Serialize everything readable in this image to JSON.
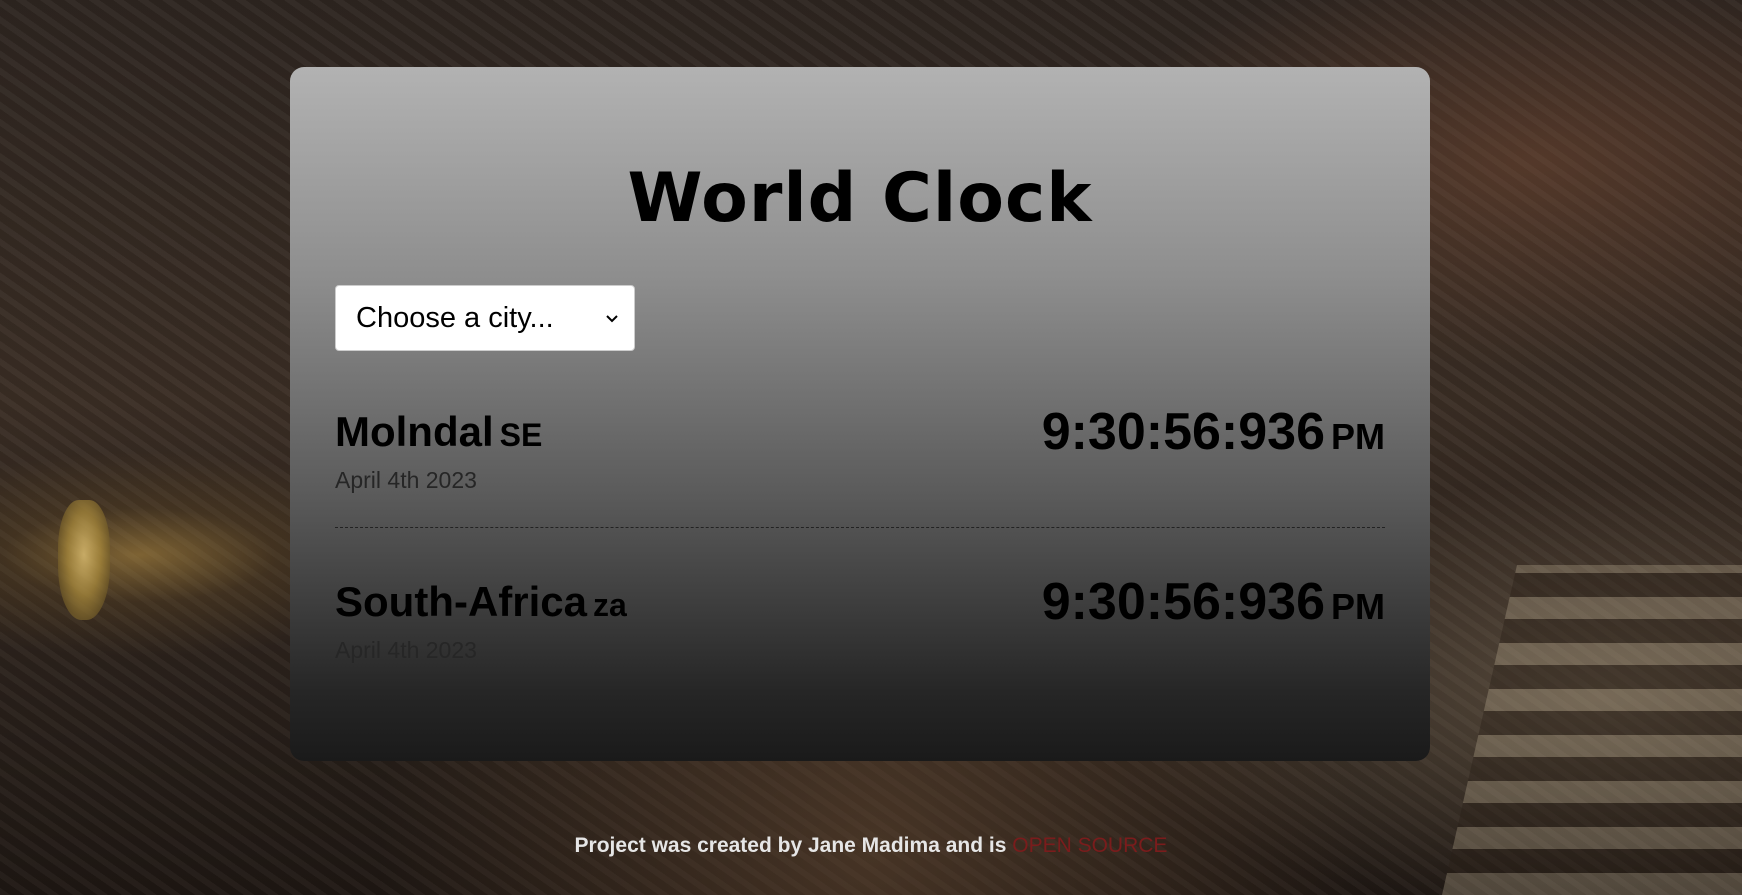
{
  "page": {
    "title": "World Clock"
  },
  "city_select": {
    "selected_label": "Choose a city...",
    "icon": "chevron-down-icon"
  },
  "cities": [
    {
      "name": "Molndal",
      "country_code": "se",
      "date": "April 4th 2023",
      "time": "9:30:56:936",
      "ampm": "PM"
    },
    {
      "name": "South-Africa",
      "country_code": "za",
      "date": "April 4th 2023",
      "time": "9:30:56:936",
      "ampm": "PM"
    }
  ],
  "footer": {
    "text": "Project was created by Jane Madima and is",
    "link_label": "OPEN SOURCE"
  },
  "colors": {
    "link": "#7a1c1c",
    "card_top": "#b2b2b2",
    "card_bottom": "#1a1a1a"
  }
}
